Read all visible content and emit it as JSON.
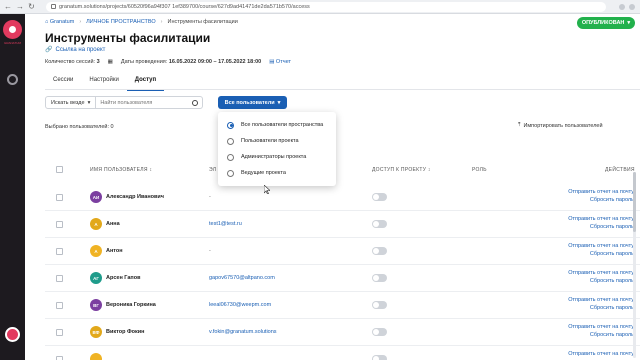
{
  "browser": {
    "url": "granatum.solutions/projects/60520f96a94f307 1ef389700/course/627d9ad41471de2da571b570/access"
  },
  "rail": {
    "logo_text": "GRANATUM"
  },
  "breadcrumb": {
    "home": "Granatum",
    "space": "ЛИЧНОЕ ПРОСТРАНСТВО",
    "current": "Инструменты фасилитации"
  },
  "header": {
    "publish_label": "ОПУБЛИКОВАН",
    "title": "Инструменты фасилитации",
    "project_link": "Ссылка на проект",
    "sessions_label": "Количество сессий:",
    "sessions_value": "3",
    "dates_label": "Даты проведения:",
    "dates_value": "16.05.2022 09:00 – 17.05.2022 18:00",
    "report_label": "Отчет"
  },
  "tabs": [
    {
      "label": "Сессии"
    },
    {
      "label": "Настройки"
    },
    {
      "label": "Доступ"
    }
  ],
  "toolbar": {
    "search_scope": "Искать везде",
    "search_placeholder": "Найти пользователя",
    "filter_label": "Все пользователи",
    "selected_text": "Выбрано пользователей: 0",
    "import_label": "Импортировать пользователей"
  },
  "filter_menu": {
    "options": [
      {
        "label": "Все пользователи пространства",
        "checked": true
      },
      {
        "label": "Пользователи проекта",
        "checked": false
      },
      {
        "label": "Администраторы проекта",
        "checked": false
      },
      {
        "label": "Ведущие проекта",
        "checked": false
      }
    ]
  },
  "table": {
    "columns": {
      "username": "ИМЯ ПОЛЬЗОВАТЕЛЯ",
      "email": "ЭЛ",
      "access": "ДОСТУП К ПРОЕКТУ",
      "role": "РОЛЬ",
      "actions": "ДЕЙСТВИЯ"
    },
    "action_report": "Отправить отчет на почту",
    "action_reset": "Сбросить пароль",
    "rows": [
      {
        "initials": "АИ",
        "color": "#7b3fa0",
        "name": "Александр Иванович",
        "email": "-"
      },
      {
        "initials": "А",
        "color": "#e2a81a",
        "name": "Анна",
        "email": "test1@test.ru"
      },
      {
        "initials": "А",
        "color": "#f0b324",
        "name": "Антон",
        "email": "-"
      },
      {
        "initials": "АГ",
        "color": "#1f9c8b",
        "name": "Арсен Гапов",
        "email": "gapov67570@altpano.com"
      },
      {
        "initials": "ВГ",
        "color": "#7b3fa0",
        "name": "Вероника Горкина",
        "email": "leeal06730@weepm.com"
      },
      {
        "initials": "ВФ",
        "color": "#e2a81a",
        "name": "Виктор Фокин",
        "email": "v.fokin@granatum.solutions"
      },
      {
        "initials": "",
        "color": "#f0b324",
        "name": "",
        "email": ""
      }
    ]
  }
}
